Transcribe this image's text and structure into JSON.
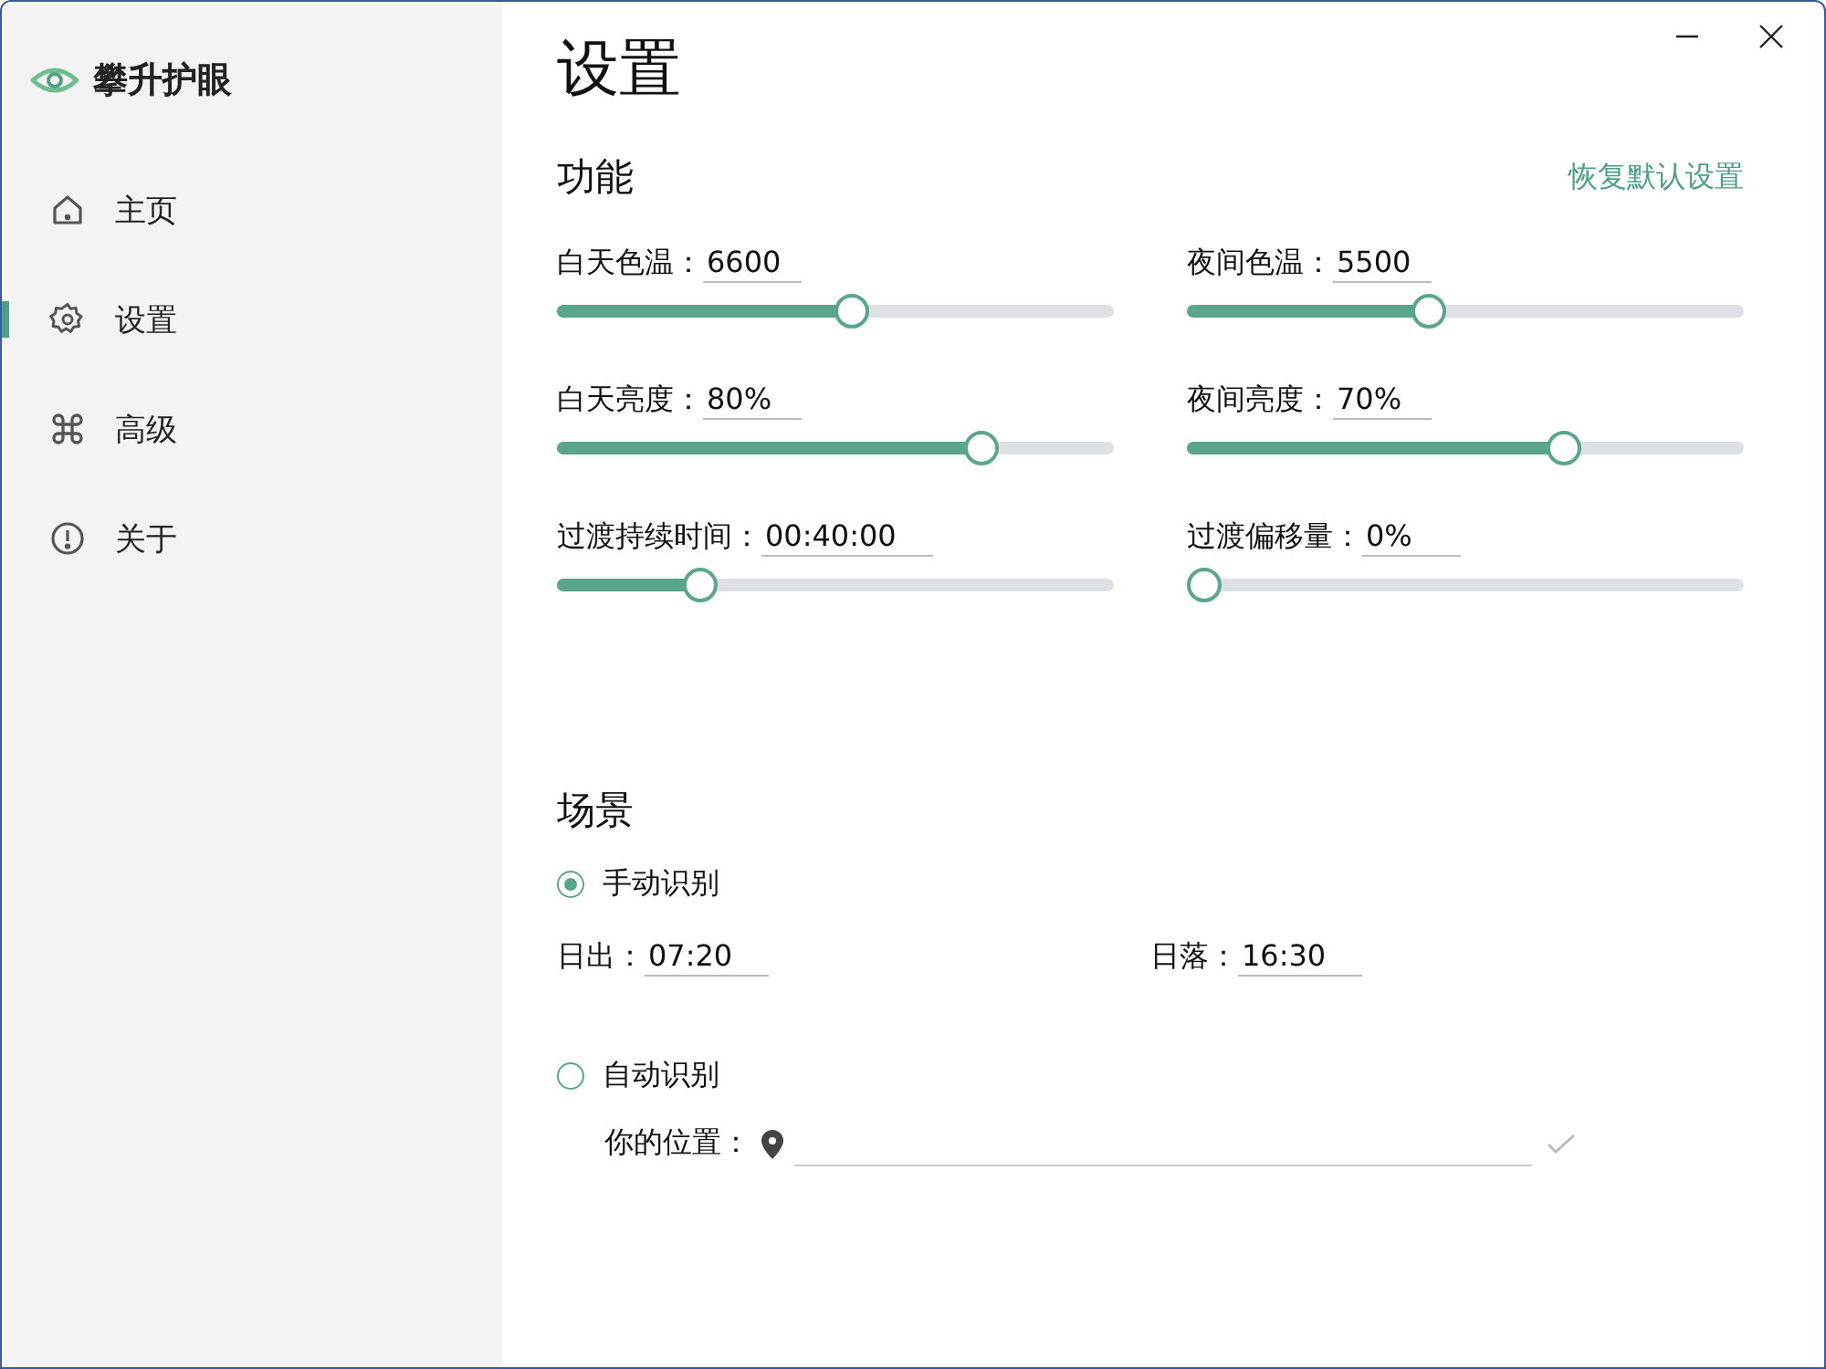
{
  "app": {
    "name": "攀升护眼"
  },
  "sidebar": {
    "items": [
      {
        "label": "主页",
        "kind": "home",
        "selected": false
      },
      {
        "label": "设置",
        "kind": "gear",
        "selected": true
      },
      {
        "label": "高级",
        "kind": "command",
        "selected": false
      },
      {
        "label": "关于",
        "kind": "info",
        "selected": false
      }
    ]
  },
  "page": {
    "title": "设置"
  },
  "features": {
    "title": "功能",
    "reset_link": "恢复默认设置",
    "sliders": [
      {
        "label": "白天色温：",
        "value": "6600",
        "level": 0.53
      },
      {
        "label": "夜间色温：",
        "value": "5500",
        "level": 0.43
      },
      {
        "label": "白天亮度：",
        "value": "80%",
        "level": 0.78
      },
      {
        "label": "夜间亮度：",
        "value": "70%",
        "level": 0.69
      },
      {
        "label": "过渡持续时间：",
        "value": "00:40:00",
        "level": 0.24
      },
      {
        "label": "过渡偏移量：",
        "value": "0%",
        "level": 0
      }
    ]
  },
  "scene": {
    "title": "场景",
    "manual": {
      "label": "手动识别",
      "selected": true,
      "sunrise_label": "日出：",
      "sunrise": "07:20",
      "sunset_label": "日落：",
      "sunset": "16:30"
    },
    "auto": {
      "label": "自动识别",
      "selected": false,
      "location_label": "你的位置："
    }
  }
}
